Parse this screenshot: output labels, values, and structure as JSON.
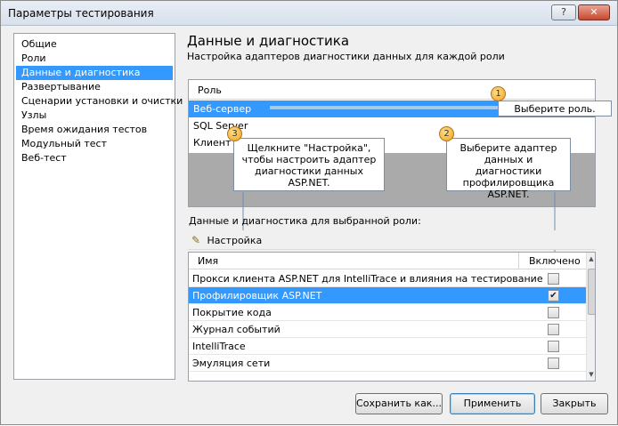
{
  "window": {
    "title": "Параметры тестирования",
    "help_label": "?",
    "close_label": "✕"
  },
  "nav": {
    "items": [
      {
        "label": "Общие"
      },
      {
        "label": "Роли"
      },
      {
        "label": "Данные и диагностика"
      },
      {
        "label": "Развертывание"
      },
      {
        "label": "Сценарии установки и очистки"
      },
      {
        "label": "Узлы"
      },
      {
        "label": "Время ожидания тестов"
      },
      {
        "label": "Модульный тест"
      },
      {
        "label": "Веб-тест"
      }
    ],
    "selected_index": 2
  },
  "page": {
    "title": "Данные и диагностика",
    "subtitle": "Настройка адаптеров диагностики данных для каждой роли"
  },
  "roles": {
    "header": "Роль",
    "rows": [
      {
        "label": "Веб-сервер"
      },
      {
        "label": "SQL Server"
      },
      {
        "label": "Клиент"
      }
    ],
    "selected_index": 0
  },
  "callouts": {
    "c1": {
      "num": "1",
      "text": "Выберите роль."
    },
    "c2": {
      "num": "2",
      "text": "Выберите адаптер данных и диагностики профилировщика ASP.NET."
    },
    "c3": {
      "num": "3",
      "text": "Щелкните \"Настройка\", чтобы настроить адаптер диагностики данных ASP.NET."
    }
  },
  "adapters": {
    "section_label": "Данные и диагностика для выбранной роли:",
    "configure_label": "Настройка",
    "col_name": "Имя",
    "col_enabled": "Включено",
    "rows": [
      {
        "name": "Прокси клиента ASP.NET для IntelliTrace и влияния на тестирование",
        "checked": false
      },
      {
        "name": "Профилировщик ASP.NET",
        "checked": true
      },
      {
        "name": "Покрытие кода",
        "checked": false
      },
      {
        "name": "Журнал событий",
        "checked": false
      },
      {
        "name": "IntelliTrace",
        "checked": false
      },
      {
        "name": "Эмуляция сети",
        "checked": false
      }
    ],
    "selected_index": 1
  },
  "buttons": {
    "save_as": "Сохранить как...",
    "apply": "Применить",
    "close": "Закрыть"
  }
}
